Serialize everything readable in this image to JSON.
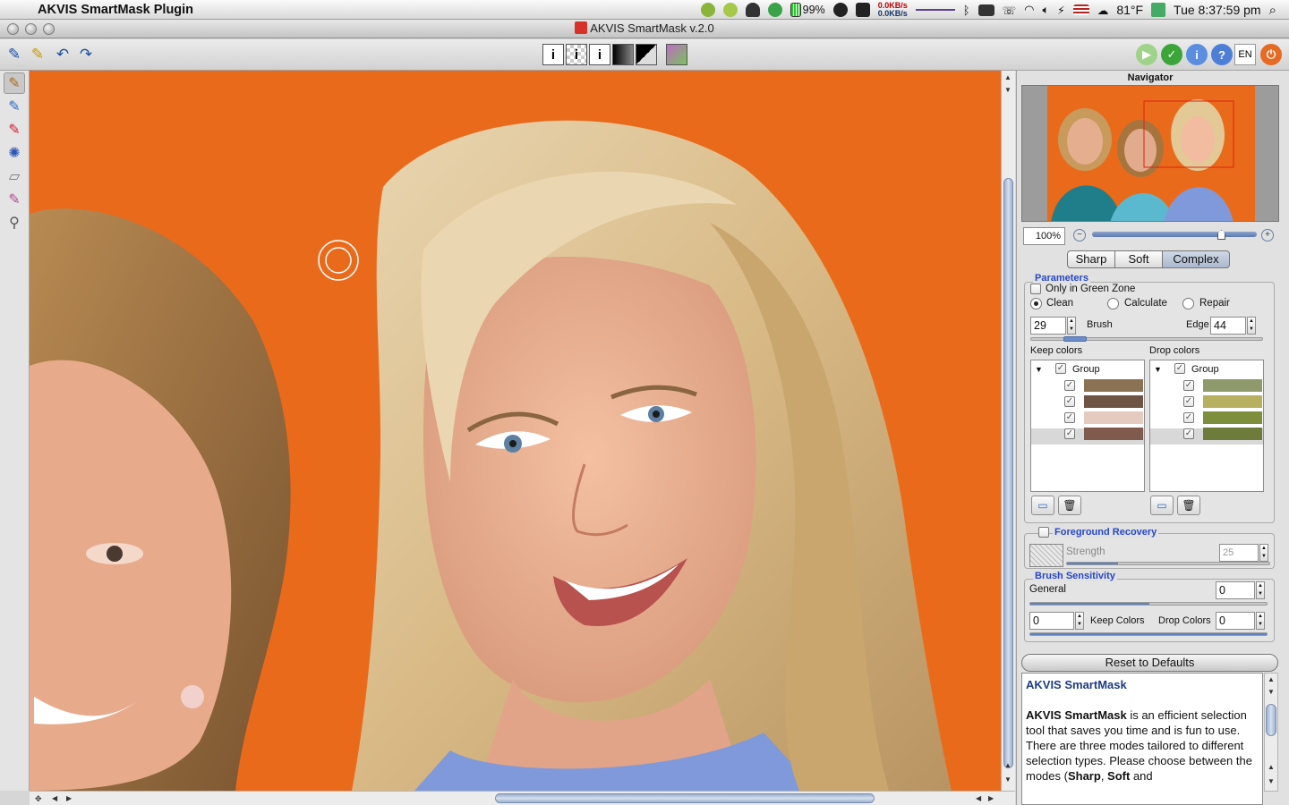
{
  "menubar": {
    "app_name": "AKVIS SmartMask Plugin",
    "battery": "99%",
    "net_up": "0.0KB/s",
    "net_down": "0.0KB/s",
    "weather": "81°F",
    "clock": "Tue 8:37:59 pm"
  },
  "window": {
    "title": "AKVIS SmartMask v.2.0"
  },
  "toolbar": {
    "lang": "EN"
  },
  "navigator": {
    "title": "Navigator",
    "zoom": "100%",
    "zoom_level": 0.8
  },
  "modes": [
    "Sharp",
    "Soft",
    "Complex"
  ],
  "parameters": {
    "legend": "Parameters",
    "only_green_zone": "Only in Green Zone",
    "clean": "Clean",
    "calculate": "Calculate",
    "repair": "Repair",
    "brush_value": "29",
    "brush_label": "Brush",
    "edge_label": "Edge",
    "edge_value": "44",
    "keep_colors_label": "Keep colors",
    "drop_colors_label": "Drop colors",
    "group_label": "Group",
    "keep_swatches": [
      "#8c7254",
      "#6f5445",
      "#e4cabf",
      "#7f5a4d"
    ],
    "drop_swatches": [
      "#8f9a6c",
      "#b6b060",
      "#7d8f3c",
      "#6e7c3b"
    ]
  },
  "foreground_recovery": {
    "legend": "Foreground Recovery",
    "strength_label": "Strength",
    "strength_value": "25"
  },
  "brush_sensitivity": {
    "legend": "Brush Sensitivity",
    "general_label": "General",
    "general_value": "0",
    "left_value": "0",
    "keep_colors": "Keep Colors",
    "drop_colors": "Drop Colors",
    "right_value": "0"
  },
  "reset_button": "Reset to Defaults",
  "help": {
    "title": "AKVIS SmartMask",
    "bold_name": "AKVIS SmartMask",
    "p1_rest": " is an efficient selection tool that saves you time and is fun to use.",
    "p2_start": "There are three modes tailored to different selection types. Please choose between the modes (",
    "sharp": "Sharp",
    "sep": ", ",
    "soft": "Soft",
    "and": " and"
  }
}
